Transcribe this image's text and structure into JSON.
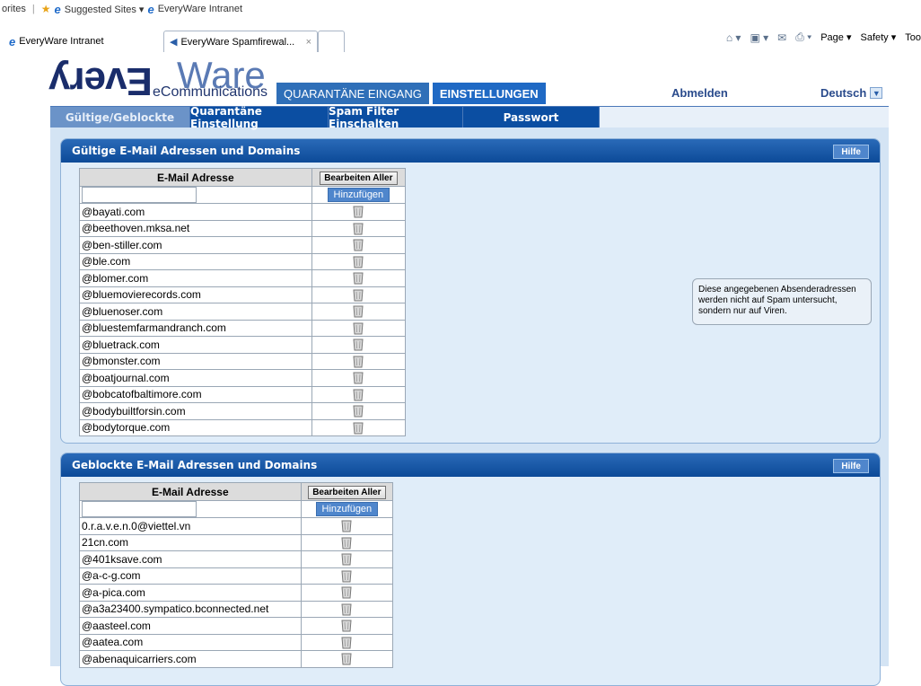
{
  "browser": {
    "favorites_label": "orites",
    "suggested_sites": "Suggested Sites ▾",
    "fav_link": "EveryWare Intranet",
    "tabs": [
      {
        "label": "EveryWare Intranet"
      },
      {
        "label": "EveryWare Spamfirewal...",
        "close": "×"
      }
    ],
    "commands": [
      "Page ▾",
      "Safety ▾",
      "Too"
    ]
  },
  "header": {
    "logo_every": "Every",
    "logo_ware": "Ware",
    "logo_sub": "eCommunications",
    "nav": [
      {
        "label": "QUARANTÄNE EINGANG"
      },
      {
        "label": "EINSTELLUNGEN"
      }
    ],
    "logout": "Abmelden",
    "language": "Deutsch"
  },
  "subnav": [
    {
      "label": "Gültige/Geblockte"
    },
    {
      "label": "Quarantäne Einstellung"
    },
    {
      "label": "Spam Filter Einschalten"
    },
    {
      "label": "Passwort"
    }
  ],
  "valid_panel": {
    "title": "Gültige E-Mail Adressen und Domains",
    "help": "Hilfe",
    "col_header": "E-Mail Adresse",
    "edit_all": "Bearbeiten Aller",
    "add": "Hinzufügen",
    "input_value": "",
    "rows": [
      "@bayati.com",
      "@beethoven.mksa.net",
      "@ben-stiller.com",
      "@ble.com",
      "@blomer.com",
      "@bluemovierecords.com",
      "@bluenoser.com",
      "@bluestemfarmandranch.com",
      "@bluetrack.com",
      "@bmonster.com",
      "@boatjournal.com",
      "@bobcatofbaltimore.com",
      "@bodybuiltforsin.com",
      "@bodytorque.com"
    ],
    "info": "Diese angegebenen Absenderadressen werden nicht auf Spam untersucht, sondern nur auf Viren."
  },
  "blocked_panel": {
    "title": "Geblockte E-Mail Adressen und Domains",
    "help": "Hilfe",
    "col_header": "E-Mail Adresse",
    "edit_all": "Bearbeiten Aller",
    "add": "Hinzufügen",
    "input_value": "",
    "rows": [
      "0.r.a.v.e.n.0@viettel.vn",
      "21cn.com",
      "@401ksave.com",
      "@a-c-g.com",
      "@a-pica.com",
      "@a3a23400.sympatico.bconnected.net",
      "@aasteel.com",
      "@aatea.com",
      "@abenaquicarriers.com"
    ]
  },
  "icons": {
    "trash": "trash-icon",
    "home": "home-icon",
    "feed": "feed-icon",
    "mail": "mail-icon",
    "print": "print-icon"
  },
  "colors": {
    "brand_dark": "#0b4ea2",
    "panel_bg": "#e0edf9",
    "accent": "#4f86cc"
  }
}
